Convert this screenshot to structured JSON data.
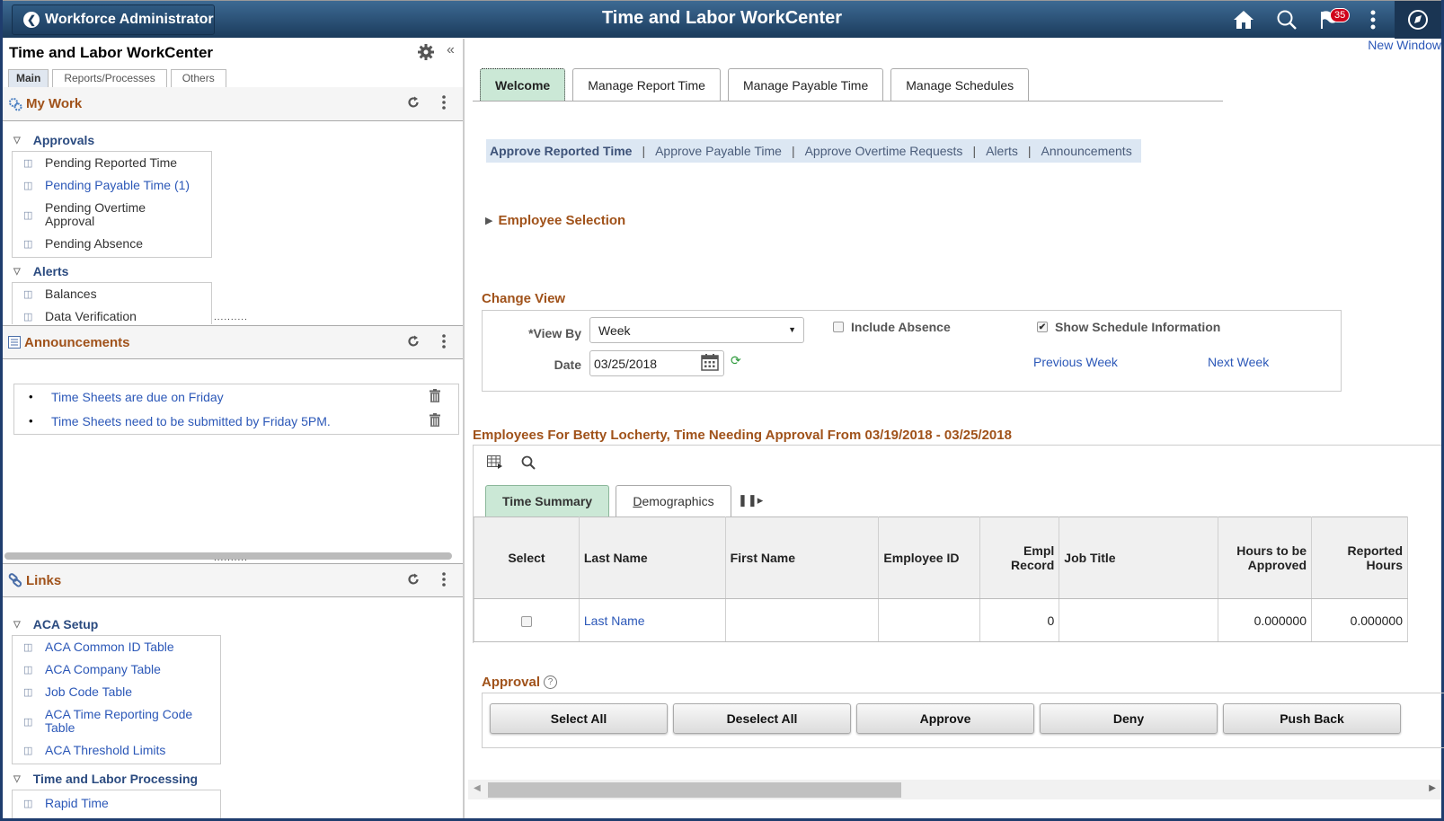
{
  "banner": {
    "back_label": "Workforce Administrator",
    "title": "Time and Labor WorkCenter",
    "notification_count": "35",
    "icons": [
      "home-icon",
      "search-icon",
      "flag-icon",
      "actions-menu-icon",
      "navbar-compass-icon"
    ]
  },
  "left_pane": {
    "title": "Time and Labor WorkCenter",
    "tabs": [
      {
        "label": "Main",
        "active": true
      },
      {
        "label": "Reports/Processes",
        "active": false
      },
      {
        "label": "Others",
        "active": false
      }
    ],
    "my_work": {
      "title": "My Work",
      "groups": [
        {
          "label": "Approvals",
          "items": [
            {
              "label": "Pending Reported Time",
              "link": false
            },
            {
              "label": "Pending Payable Time (1)",
              "link": true
            },
            {
              "label": "Pending Overtime Approval",
              "link": false
            },
            {
              "label": "Pending Absence",
              "link": false
            }
          ]
        },
        {
          "label": "Alerts",
          "items": [
            {
              "label": "Balances",
              "link": false
            },
            {
              "label": "Data Verification",
              "link": false
            }
          ]
        }
      ]
    },
    "announcements": {
      "title": "Announcements",
      "items": [
        "Time Sheets are due on Friday",
        "Time Sheets need to be submitted by Friday 5PM."
      ]
    },
    "links": {
      "title": "Links",
      "groups": [
        {
          "label": "ACA Setup",
          "items": [
            "ACA Common ID Table",
            "ACA Company Table",
            "Job Code Table",
            "ACA Time Reporting Code Table",
            "ACA Threshold Limits"
          ]
        },
        {
          "label": "Time and Labor Processing",
          "items": [
            "Rapid Time"
          ]
        }
      ]
    }
  },
  "main": {
    "new_window": "New Window",
    "tabs": [
      {
        "label": "Welcome",
        "active": true
      },
      {
        "label": "Manage Report Time",
        "active": false
      },
      {
        "label": "Manage Payable Time",
        "active": false
      },
      {
        "label": "Manage Schedules",
        "active": false
      }
    ],
    "subnav": [
      {
        "label": "Approve Reported Time",
        "active": true
      },
      {
        "label": "Approve Payable Time",
        "active": false
      },
      {
        "label": "Approve Overtime Requests",
        "active": false
      },
      {
        "label": "Alerts",
        "active": false
      },
      {
        "label": "Announcements",
        "active": false
      }
    ],
    "employee_selection": "Employee Selection",
    "change_view": {
      "title": "Change View",
      "view_by_label": "*View By",
      "view_by_value": "Week",
      "date_label": "Date",
      "date_value": "03/25/2018",
      "include_absence_label": "Include Absence",
      "include_absence_checked": false,
      "show_schedule_label": "Show Schedule Information",
      "show_schedule_checked": true,
      "previous_week": "Previous Week",
      "next_week": "Next Week"
    },
    "grid": {
      "title": "Employees For Betty Locherty, Time Needing Approval From 03/19/2018 - 03/25/2018",
      "tabs": [
        {
          "label": "Time Summary",
          "active": true
        },
        {
          "label": "Demographics",
          "active": false
        }
      ],
      "columns": [
        "Select",
        "Last Name",
        "First Name",
        "Employee ID",
        "Empl Record",
        "Job Title",
        "Hours to be Approved",
        "Reported Hours"
      ],
      "rows": [
        {
          "select": false,
          "last_name": "Last Name",
          "first_name": "",
          "employee_id": "",
          "empl_record": "0",
          "job_title": "",
          "hours_to_be_approved": "0.000000",
          "reported_hours": "0.000000"
        }
      ]
    },
    "approval": {
      "title": "Approval",
      "buttons": [
        "Select All",
        "Deselect All",
        "Approve",
        "Deny",
        "Push Back"
      ]
    }
  }
}
